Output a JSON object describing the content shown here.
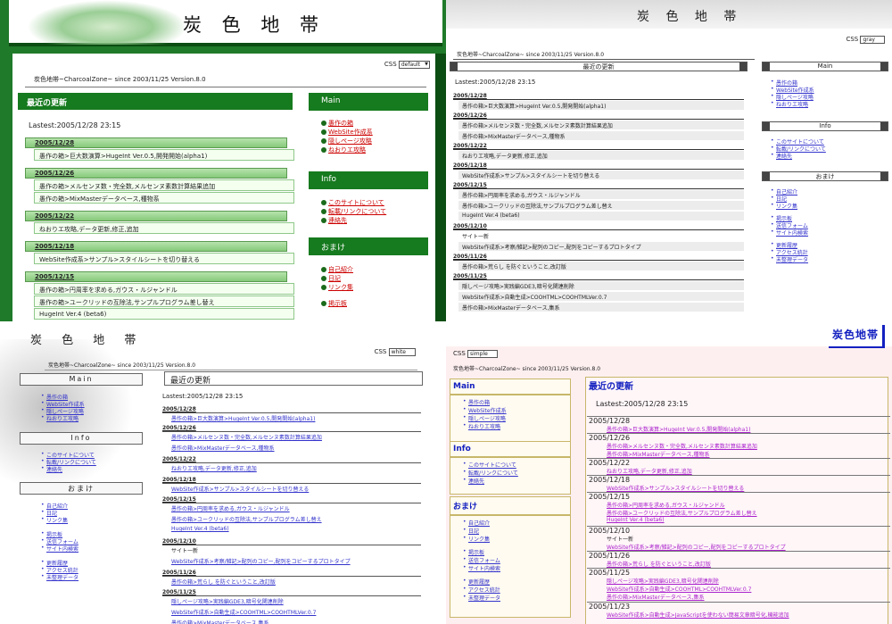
{
  "site": {
    "title": "炭色地帯",
    "title_spaced": "炭 色 地 帯",
    "since": "炭色地帯~CharcoalZone~ since 2003/11/25  Version.8.0",
    "css_label": "CSS",
    "latest": "Lastest:2005/12/28 23:15",
    "recent_heading": "最近の更新"
  },
  "themes": {
    "q1": "default",
    "q2": "gray",
    "q3": "white",
    "q4": "simple"
  },
  "colors": {
    "green": "#167a1e",
    "link_blue": "#3333cc",
    "title_blue": "#1320c0",
    "pink_bg": "#fdeff0"
  },
  "sidebar": [
    {
      "heading": "Main",
      "items": [
        "愚作の箱",
        "WebSite作成系",
        "隠しページ攻略",
        "ねおりエ攻略"
      ]
    },
    {
      "heading": "Info",
      "items": [
        "このサイトについて",
        "転載/リンクについて",
        "連絡先"
      ]
    },
    {
      "heading": "おまけ",
      "items": [
        "自己紹介",
        "日記",
        "リンク集",
        "掲示板",
        "送信フォーム",
        "サイト内検索",
        "更新履歴",
        "アクセス統計",
        "未整理データ"
      ]
    }
  ],
  "updates": [
    {
      "date": "2005/12/28",
      "entries": [
        "愚作の箱>巨大数演算>HugeInt Ver.0.5,開発開始(alpha1)"
      ]
    },
    {
      "date": "2005/12/26",
      "entries": [
        "愚作の箱>メルセンヌ数・完全数,メルセンヌ素数計算結果追加",
        "愚作の箱>MixMasterデータベース,種物系"
      ]
    },
    {
      "date": "2005/12/22",
      "entries": [
        "ねおりエ攻略,データ更新,修正,追加"
      ]
    },
    {
      "date": "2005/12/18",
      "entries": [
        "WebSite作成系>サンプル>スタイルシートを切り替える"
      ]
    },
    {
      "date": "2005/12/15",
      "entries": [
        "愚作の箱>円周率を求める,ガウス・ルジャンドル",
        "愚作の箱>ユークリッドの互除法,サンプルプログラム差し替え",
        "HugeInt Ver.4 (beta6)"
      ]
    },
    {
      "date": "2005/12/10",
      "entries": [
        "サイト一新",
        "WebSite作成系>考察/雑記>配列のコピー,配列をコピーするプロトタイプ"
      ]
    },
    {
      "date": "2005/11/26",
      "entries": [
        "愚作の箱>荒らし を防ぐということ,改訂版"
      ]
    },
    {
      "date": "2005/11/25",
      "entries": [
        "隠しページ攻略>実践編GDE3,暗号化関連削除",
        "WebSite作成系>自動生成>COOHTML>COOHTMLVer.0.7",
        "愚作の箱>MixMasterデータベース,集系"
      ]
    },
    {
      "date": "2005/11/23",
      "entries": [
        "WebSite作成系>自動生成>JavaScriptを使わない簡易文章暗号化,機能追加"
      ]
    }
  ]
}
